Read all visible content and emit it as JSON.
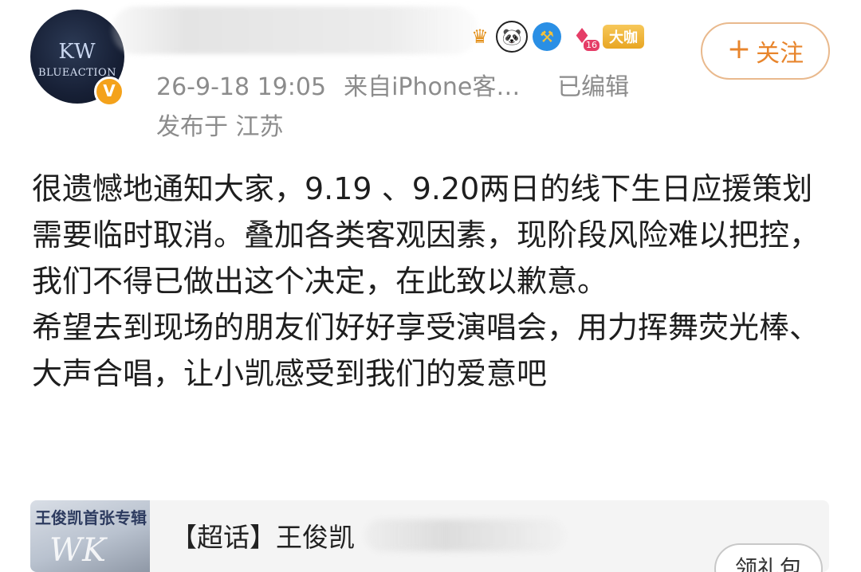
{
  "post": {
    "avatar": {
      "logo_mark": "KW",
      "logo_text": "BLUEACTION",
      "verified_mark": "V"
    },
    "badges": [
      {
        "icon": "crown-icon",
        "glyph": "♛"
      },
      {
        "icon": "panda-icon",
        "glyph": "🐼"
      },
      {
        "icon": "shield-hammer-icon",
        "glyph": "⚒"
      },
      {
        "icon": "diamond-level-icon",
        "glyph": "♦",
        "level": "16"
      },
      {
        "icon": "vip-badge",
        "label": "大咖"
      }
    ],
    "follow_label": "关注",
    "follow_plus": "+",
    "timestamp": "26-9-18 19:05",
    "source": "来自iPhone客…",
    "edited": "已编辑",
    "location": "发布于 江苏",
    "paragraphs": [
      "很遗憾地通知大家，9.19 、9.20两日的线下生日应援策划需要临时取消。叠加各类客观因素，现阶段风险难以把控，我们不得已做出这个决定，在此致以歉意。",
      "希望去到现场的朋友们好好享受演唱会，用力挥舞荧光棒、大声合唱，让小凯感受到我们的爱意吧"
    ]
  },
  "card": {
    "thumb_title": "王俊凯首张专辑",
    "thumb_mark": "WK",
    "title": "【超话】王俊凯",
    "button_label": "领礼包"
  }
}
